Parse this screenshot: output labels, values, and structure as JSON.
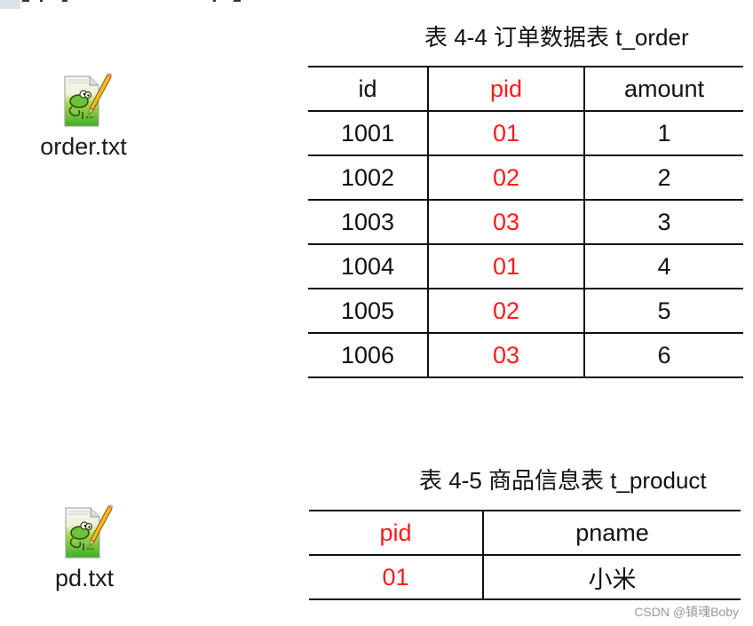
{
  "files": [
    {
      "name": "order.txt",
      "icon": "notepad-plus-plus-file-icon"
    },
    {
      "name": "pd.txt",
      "icon": "notepad-plus-plus-file-icon"
    }
  ],
  "order_table": {
    "caption": "表 4-4  订单数据表 t_order",
    "headers": [
      "id",
      "pid",
      "amount"
    ],
    "rows": [
      [
        "1001",
        "01",
        "1"
      ],
      [
        "1002",
        "02",
        "2"
      ],
      [
        "1003",
        "03",
        "3"
      ],
      [
        "1004",
        "01",
        "4"
      ],
      [
        "1005",
        "02",
        "5"
      ],
      [
        "1006",
        "03",
        "6"
      ]
    ]
  },
  "product_table": {
    "caption": "表 4-5  商品信息表 t_product",
    "headers": [
      "pid",
      "pname"
    ],
    "rows": [
      [
        "01",
        "小米"
      ]
    ]
  },
  "highlight_color": "#ff1a1a",
  "watermark": "CSDN @镇魂Boby"
}
